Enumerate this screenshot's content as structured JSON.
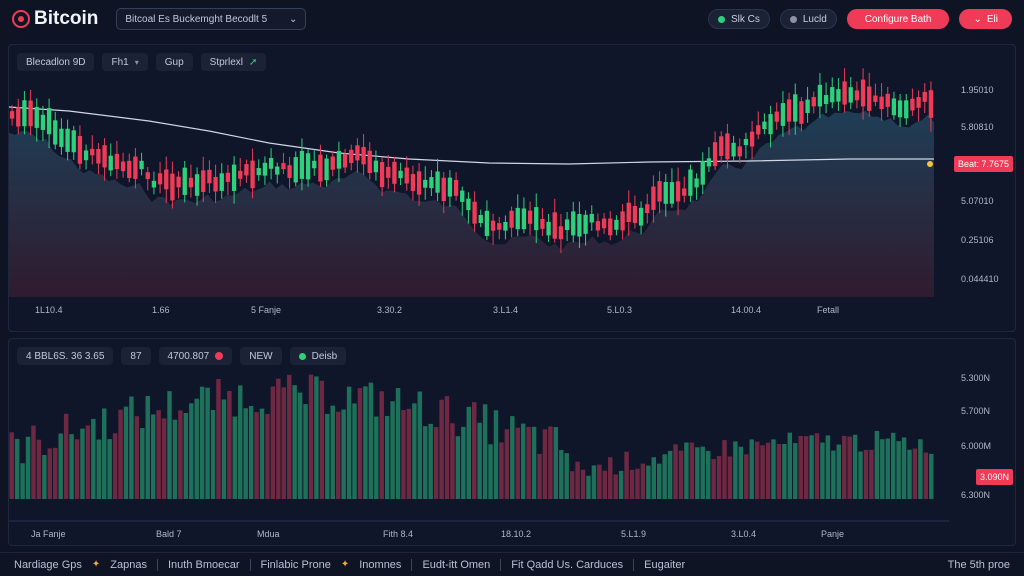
{
  "header": {
    "logo_text": "Bitcoin",
    "pair_select": "Bitcoal Es Buckemght Becodlt 5",
    "status_pill": "Slk Cs",
    "load_pill": "Lucld",
    "cta_button": "Configure Bath",
    "small_button": "Eli"
  },
  "price_toolbar": [
    "Blecadlon 9D",
    "Fh1",
    "Gup",
    "Stprlexl"
  ],
  "price_axis": [
    "1.95010",
    "5.80810",
    "5.07010",
    "0.25106",
    "0.044410"
  ],
  "price_tag": "Beat: 7.7675",
  "price_x_labels": [
    "1L10.4",
    "1.66",
    "5 Fanje",
    "3.30.2",
    "3.L1.4",
    "5.L0.3",
    "14.00.4",
    "Fetall"
  ],
  "volume_toolbar": [
    "4 BBL6S. 36 3.65",
    "87",
    "4700.807",
    "NEW",
    "Deisb"
  ],
  "volume_axis": [
    "5.300N",
    "5.700N",
    "6.000M",
    "6.300N"
  ],
  "volume_tag": "3.090N",
  "volume_x_labels": [
    "Ja Fanje",
    "Bald 7",
    "Mdua",
    "Fith 8.4",
    "18.10.2",
    "5.L1.9",
    "3.L0.4",
    "Panje"
  ],
  "footer": {
    "items": [
      "Nardiage Gps",
      "Zapnas",
      "Inuth Bmoecar",
      "Finlabic Prone",
      "Inomnes",
      "Eudt-itt Omen",
      "Fit Qadd Us. Carduces",
      "Eugaiter"
    ],
    "right_text": "The 5th proe"
  },
  "colors": {
    "bull": "#2fd07b",
    "bear": "#ef3b57",
    "background": "#0f1424",
    "accent": "#ef3b57"
  },
  "icons": [
    "bitcoin-logo-icon",
    "chevron-down-icon",
    "arrow-up-icon",
    "status-dot-icon"
  ]
}
